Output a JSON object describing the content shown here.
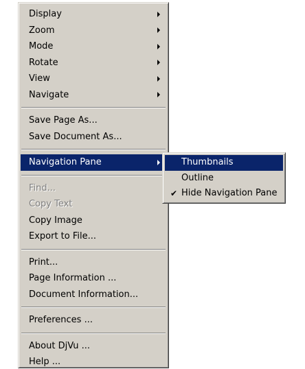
{
  "main_menu": {
    "group1": [
      {
        "label": "Display"
      },
      {
        "label": "Zoom"
      },
      {
        "label": "Mode"
      },
      {
        "label": "Rotate"
      },
      {
        "label": "View"
      },
      {
        "label": "Navigate"
      }
    ],
    "group2": [
      {
        "label": "Save Page As..."
      },
      {
        "label": "Save Document As..."
      }
    ],
    "group3": [
      {
        "label": "Navigation Pane"
      }
    ],
    "group4": [
      {
        "label": "Find...",
        "disabled": true
      },
      {
        "label": "Copy Text",
        "disabled": true
      },
      {
        "label": "Copy Image"
      },
      {
        "label": "Export to File..."
      }
    ],
    "group5": [
      {
        "label": "Print..."
      },
      {
        "label": "Page Information ..."
      },
      {
        "label": "Document Information..."
      }
    ],
    "group6": [
      {
        "label": "Preferences ..."
      }
    ],
    "group7": [
      {
        "label": "About DjVu ..."
      },
      {
        "label": "Help ..."
      }
    ]
  },
  "submenu": {
    "items": [
      {
        "label": "Thumbnails",
        "highlighted": true
      },
      {
        "label": "Outline"
      },
      {
        "label": "Hide Navigation Pane",
        "checked": true,
        "check_glyph": "✔"
      }
    ]
  },
  "colors": {
    "menu_bg": "#d4d0c8",
    "highlight_bg": "#0a246a",
    "highlight_text": "#ffffff",
    "disabled_text": "#808080"
  },
  "icons": {
    "submenu_arrow": "triangle-right-icon",
    "check": "checkmark-icon"
  }
}
